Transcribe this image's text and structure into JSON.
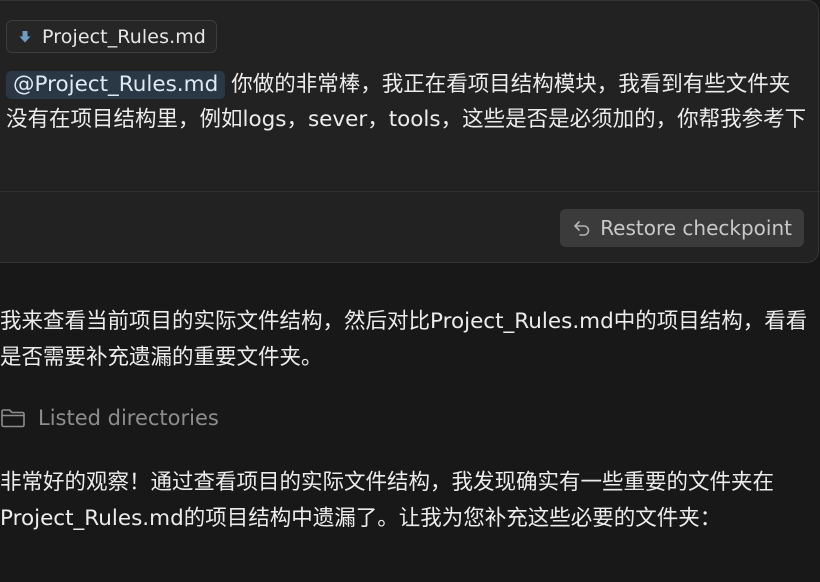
{
  "user_message": {
    "attachment_chip": {
      "icon": "download-arrow-icon",
      "label": "Project_Rules.md"
    },
    "mention": "@Project_Rules.md",
    "text": "你做的非常棒，我正在看项目结构模块，我看到有些文件夹没有在项目结构里，例如logs，sever，tools，这些是否是必须加的，你帮我参考下"
  },
  "restore_button": {
    "icon": "restore-arrow-icon",
    "label": "Restore checkpoint"
  },
  "assistant": {
    "intro": "我来查看当前项目的实际文件结构，然后对比Project_Rules.md中的项目结构，看看是否需要补充遗漏的重要文件夹。",
    "tool_call": {
      "icon": "folder-icon",
      "label": "Listed directories"
    },
    "followup": "非常好的观察！通过查看项目的实际文件结构，我发现确实有一些重要的文件夹在Project_Rules.md的项目结构中遗漏了。让我为您补充这些必要的文件夹："
  },
  "colors": {
    "background": "#181818",
    "card": "#222222",
    "mention_bg": "#2a3845",
    "button_bg": "#3b3b3b",
    "muted_text": "#8d8d8d"
  }
}
